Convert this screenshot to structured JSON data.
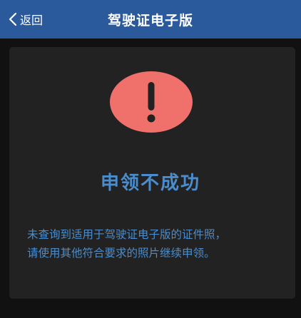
{
  "nav": {
    "back_label": "返回",
    "title": "驾驶证电子版"
  },
  "result": {
    "icon": "exclamation-icon",
    "title": "申领不成功",
    "message_line1": "未查询到适用于驾驶证电子版的证件照，",
    "message_line2": "请使用其他符合要求的照片继续申领。"
  },
  "colors": {
    "nav_bg": "#2b5a9c",
    "page_bg": "#111111",
    "card_bg": "#222222",
    "alert_red": "#f0716b",
    "accent_blue": "#4b8dcc"
  }
}
